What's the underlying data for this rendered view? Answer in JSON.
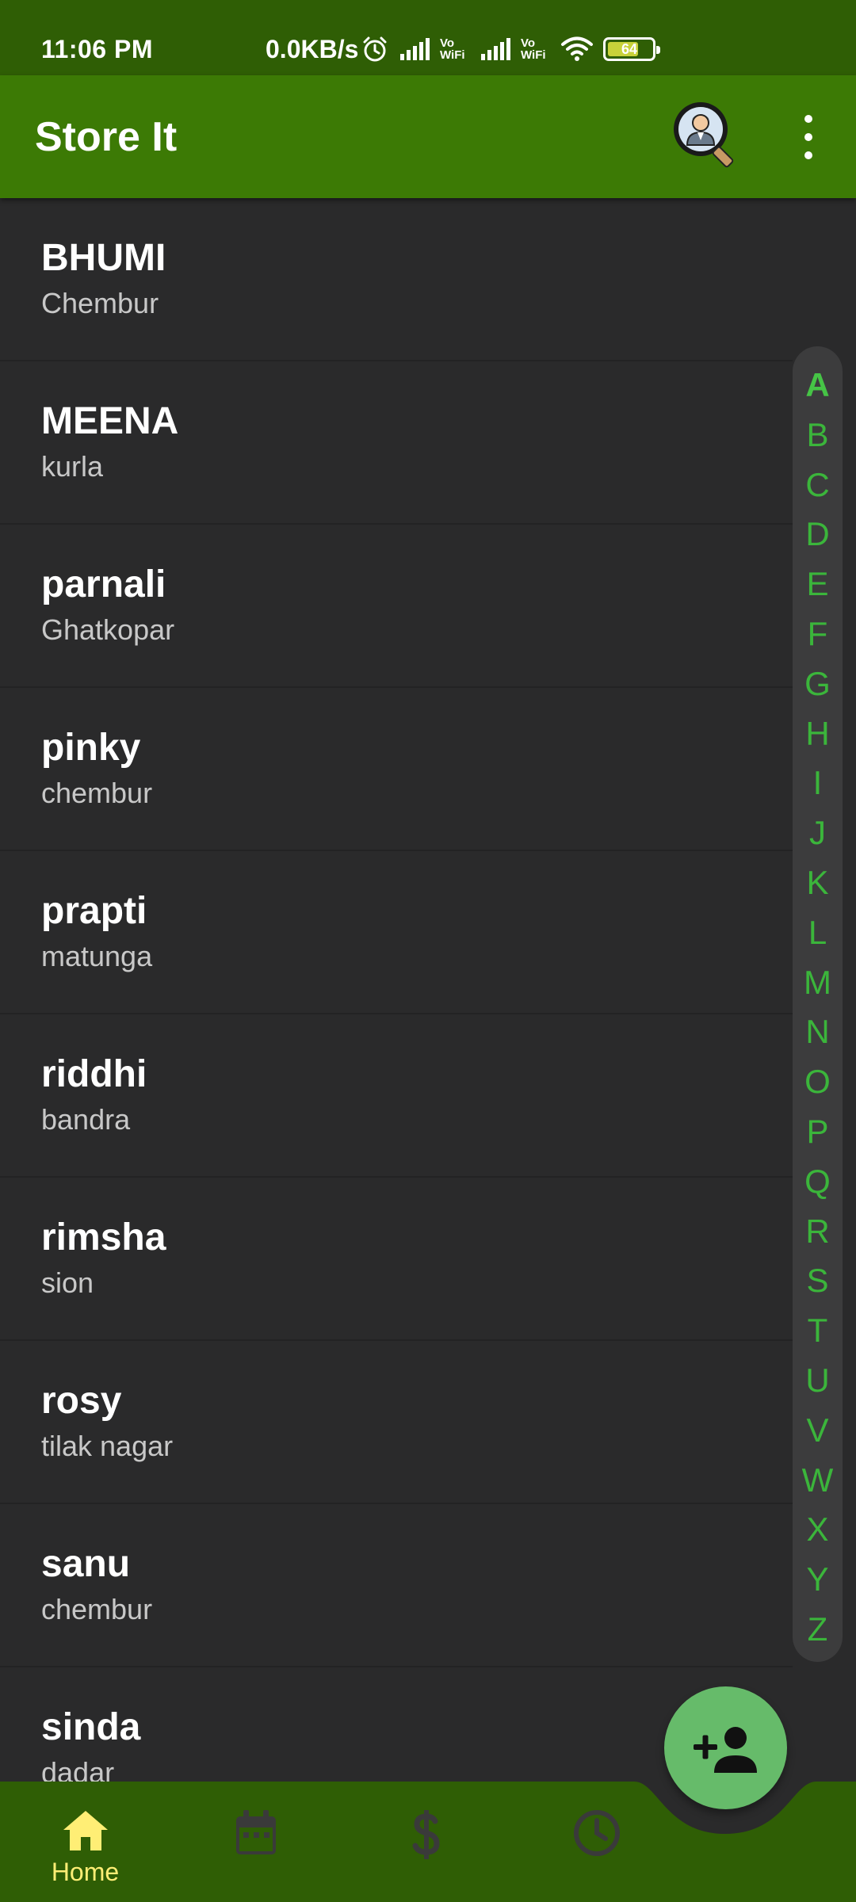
{
  "status_bar": {
    "time": "11:06 PM",
    "network_speed": "0.0KB/s",
    "vowifi_label": "Vo WiFi",
    "battery_level": "64",
    "icons": [
      "alarm-icon",
      "signal-icon",
      "vowifi-icon",
      "signal-icon",
      "vowifi-icon",
      "wifi-icon",
      "battery-icon"
    ]
  },
  "app_bar": {
    "title": "Store It",
    "icons": [
      "search-user-icon",
      "more-vert-icon"
    ]
  },
  "contacts": [
    {
      "name": "BHUMI",
      "area": "Chembur"
    },
    {
      "name": "MEENA",
      "area": "kurla"
    },
    {
      "name": "parnali",
      "area": "Ghatkopar"
    },
    {
      "name": "pinky",
      "area": "chembur"
    },
    {
      "name": "prapti",
      "area": "matunga"
    },
    {
      "name": "riddhi",
      "area": "bandra"
    },
    {
      "name": "rimsha",
      "area": "sion"
    },
    {
      "name": "rosy",
      "area": "tilak nagar"
    },
    {
      "name": "sanu",
      "area": "chembur"
    },
    {
      "name": "sinda",
      "area": "dadar"
    }
  ],
  "alphabet_index": {
    "letters": [
      "A",
      "B",
      "C",
      "D",
      "E",
      "F",
      "G",
      "H",
      "I",
      "J",
      "K",
      "L",
      "M",
      "N",
      "O",
      "P",
      "Q",
      "R",
      "S",
      "T",
      "U",
      "V",
      "W",
      "X",
      "Y",
      "Z"
    ],
    "selected": "A"
  },
  "fab": {
    "icon": "add-person-icon"
  },
  "bottom_nav": {
    "items": [
      {
        "label": "Home",
        "icon": "home-icon",
        "active": true
      },
      {
        "label": "",
        "icon": "calendar-icon",
        "active": false
      },
      {
        "label": "",
        "icon": "dollar-icon",
        "active": false
      },
      {
        "label": "",
        "icon": "clock-icon",
        "active": false
      }
    ]
  },
  "colors": {
    "status_bar": "#2f5e05",
    "app_bar": "#3c7a05",
    "list_background": "#2a2a2b",
    "bottom_nav": "#2f5e05",
    "fab": "#66bb6a",
    "index_letter": "#3bb53b",
    "active_nav": "#ffee75",
    "inactive_nav": "#3a3a3a"
  }
}
